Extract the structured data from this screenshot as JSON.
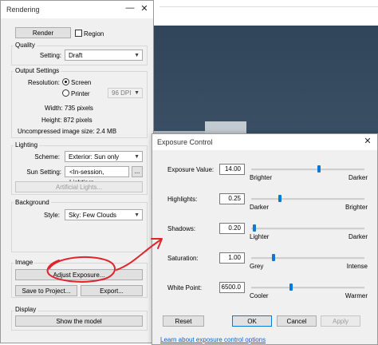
{
  "rendering": {
    "title": "Rendering",
    "minimize_glyph": "—",
    "close_glyph": "✕",
    "render_label": "Render",
    "region_label": "Region",
    "quality": {
      "group": "Quality",
      "setting_label": "Setting:",
      "setting_value": "Draft"
    },
    "output": {
      "group": "Output Settings",
      "resolution_label": "Resolution:",
      "screen_label": "Screen",
      "printer_label": "Printer",
      "dpi_value": "96 DPI",
      "width": "Width:  735 pixels",
      "height": "Height:  872 pixels",
      "size": "Uncompressed image size:  2.4 MB"
    },
    "lighting": {
      "group": "Lighting",
      "scheme_label": "Scheme:",
      "scheme_value": "Exterior: Sun only",
      "sun_label": "Sun Setting:",
      "sun_value": "<In-session, Lighting>",
      "sun_more": "...",
      "artificial_label": "Artificial Lights..."
    },
    "background": {
      "group": "Background",
      "style_label": "Style:",
      "style_value": "Sky: Few Clouds"
    },
    "image": {
      "group": "Image",
      "adjust_label": "Adjust Exposure...",
      "save_label": "Save to Project...",
      "export_label": "Export..."
    },
    "display": {
      "group": "Display",
      "show_label": "Show the model"
    }
  },
  "exposure": {
    "title": "Exposure Control",
    "close_glyph": "✕",
    "rows": [
      {
        "label": "Exposure Value:",
        "value": "14.00",
        "left": "Brighter",
        "right": "Darker",
        "level": 0.6
      },
      {
        "label": "Highlights:",
        "value": "0.25",
        "left": "Darker",
        "right": "Brighter",
        "level": 0.25
      },
      {
        "label": "Shadows:",
        "value": "0.20",
        "left": "Lighter",
        "right": "Darker",
        "level": 0.03
      },
      {
        "label": "Saturation:",
        "value": "1.00",
        "left": "Grey",
        "right": "Intense",
        "level": 0.2
      },
      {
        "label": "White Point:",
        "value": "6500.0",
        "left": "Cooler",
        "right": "Warmer",
        "level": 0.35
      }
    ],
    "reset_label": "Reset",
    "ok_label": "OK",
    "cancel_label": "Cancel",
    "apply_label": "Apply",
    "link_text": "Learn about exposure control options"
  },
  "colors": {
    "annotation": "#e0242a",
    "slider_thumb": "#0a78d7",
    "link": "#1060c0"
  }
}
